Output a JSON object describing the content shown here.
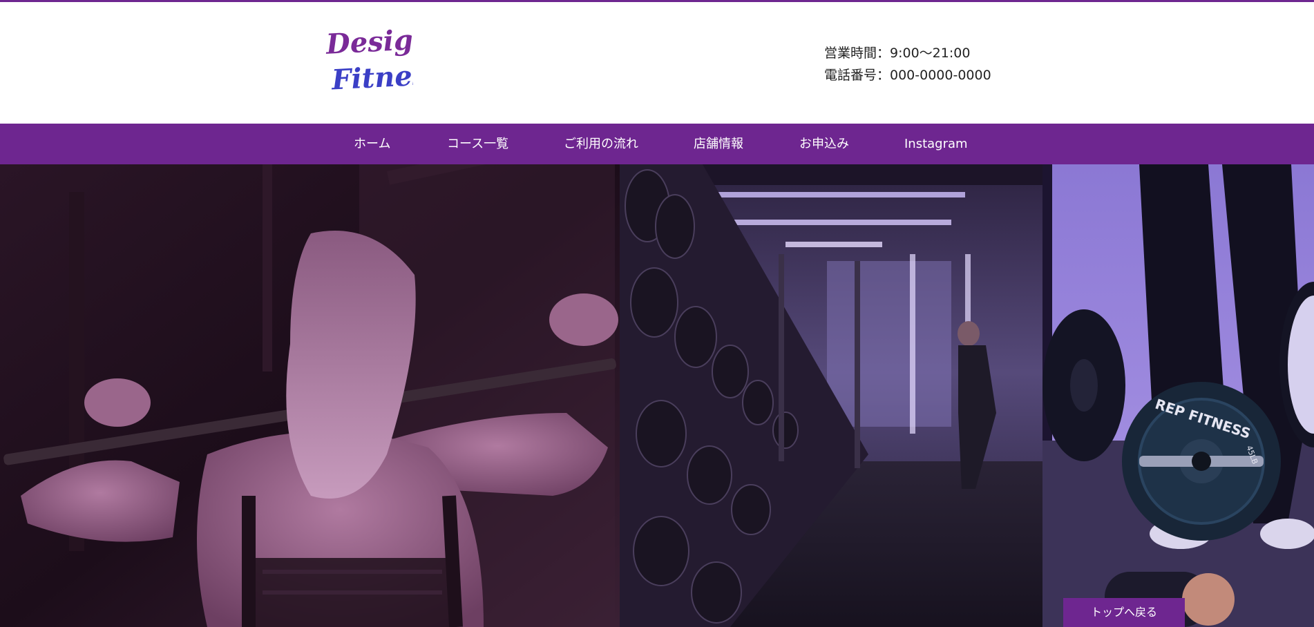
{
  "brand": {
    "logo_line1": "Design",
    "logo_line2": "Fitness",
    "accent_color": "#6e2690",
    "logo_color_top": "#7a2a98",
    "logo_color_bottom": "#3b3fc6"
  },
  "header": {
    "hours": "営業時間：9:00〜21:00",
    "phone": "電話番号：000-0000-0000"
  },
  "nav": {
    "items": [
      {
        "label": "ホーム"
      },
      {
        "label": "コース一覧"
      },
      {
        "label": "ご利用の流れ"
      },
      {
        "label": "店舗情報"
      },
      {
        "label": "お申込み"
      },
      {
        "label": "Instagram"
      }
    ]
  },
  "hero": {
    "plate_text": "REP FITNESS",
    "plate_weight": "45LB"
  },
  "back_to_top": {
    "label": "トップへ戻る"
  }
}
